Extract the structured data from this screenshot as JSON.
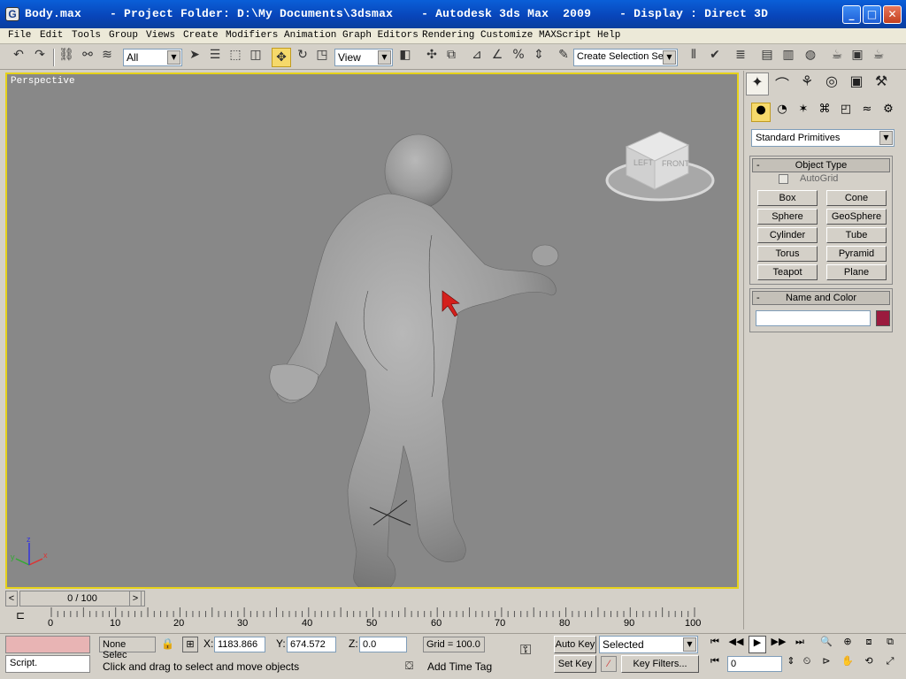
{
  "window": {
    "title": "Body.max    - Project Folder: D:\\My Documents\\3dsmax    - Autodesk 3ds Max  2009    - Display : Direct 3D",
    "minimize": "_",
    "maximize": "□",
    "close": "✕"
  },
  "menu": [
    "File",
    "Edit",
    "Tools",
    "Group",
    "Views",
    "Create",
    "Modifiers",
    "Animation",
    "Graph Editors",
    "Rendering",
    "Customize",
    "MAXScript",
    "Help"
  ],
  "toolbar": {
    "selection_filter": "All",
    "reference_coord": "View",
    "named_selection_placeholder": "Create Selection Set"
  },
  "viewport": {
    "label": "Perspective",
    "viewcube_left": "LEFT",
    "viewcube_front": "FRONT",
    "axis_x": "x",
    "axis_y": "y",
    "axis_z": "z"
  },
  "command_panel": {
    "category_dropdown": "Standard Primitives",
    "object_type_title": "Object Type",
    "autogrid_label": "AutoGrid",
    "primitives": [
      "Box",
      "Cone",
      "Sphere",
      "GeoSphere",
      "Cylinder",
      "Tube",
      "Torus",
      "Pyramid",
      "Teapot",
      "Plane"
    ],
    "name_color_title": "Name and Color",
    "object_name": "",
    "object_color": "#9b1b3e"
  },
  "timeline": {
    "slider": "0 / 100",
    "prev": "<",
    "next": ">",
    "ticks": [
      "0",
      "10",
      "20",
      "30",
      "40",
      "50",
      "60",
      "70",
      "80",
      "90",
      "100"
    ]
  },
  "status": {
    "maxscript": "Script.",
    "selection": "None Selec",
    "x_label": "X:",
    "x_value": "1183.866",
    "y_label": "Y:",
    "y_value": "674.572",
    "z_label": "Z:",
    "z_value": "0.0",
    "grid": "Grid = 100.0",
    "prompt": "Click and drag to select and move objects",
    "add_time_tag": "Add Time Tag",
    "auto_key": "Auto Key",
    "set_key": "Set Key",
    "key_mode": "Selected",
    "key_filters": "Key Filters...",
    "frame": "0"
  }
}
